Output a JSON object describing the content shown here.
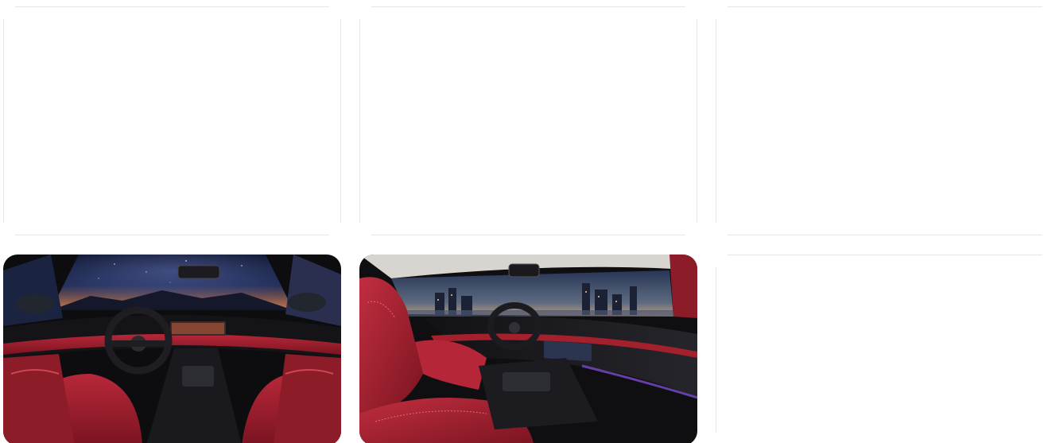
{
  "gallery": {
    "cards": [
      {
        "id": "card-1",
        "state": "empty"
      },
      {
        "id": "card-2",
        "state": "empty"
      },
      {
        "id": "card-3",
        "state": "empty"
      },
      {
        "id": "card-4",
        "state": "image",
        "image": "car-interior-front-view-night-sky"
      },
      {
        "id": "card-5",
        "state": "image",
        "image": "car-interior-side-view-city-skyline"
      },
      {
        "id": "card-6",
        "state": "empty"
      }
    ]
  },
  "colors": {
    "leather_red": "#a3202c",
    "dash_black": "#151518",
    "night_sky": "#0e1530",
    "placeholder_line": "#e6e6e6"
  }
}
